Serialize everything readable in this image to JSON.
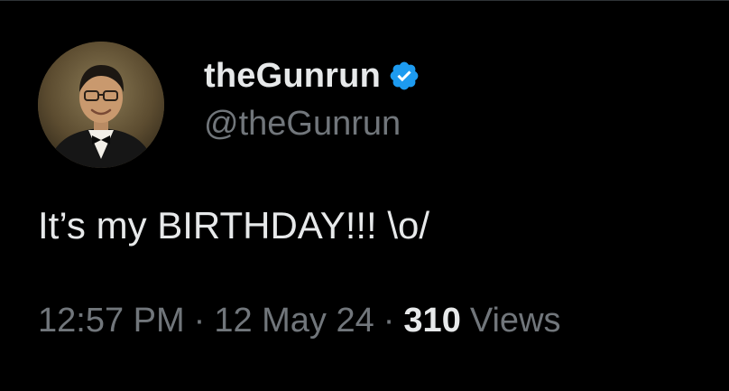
{
  "tweet": {
    "display_name": "theGunrun",
    "handle": "@theGunrun",
    "verified_icon": "verified-badge-icon",
    "text": "It’s my BIRTHDAY!!! \\o/",
    "time": "12:57 PM",
    "separator": "·",
    "date": "12 May 24",
    "views_count": "310",
    "views_label": "Views"
  },
  "colors": {
    "background": "#000000",
    "primary_text": "#e7e9ea",
    "secondary_text": "#71767b",
    "verified_blue": "#1d9bf0",
    "divider": "#2f3336"
  }
}
